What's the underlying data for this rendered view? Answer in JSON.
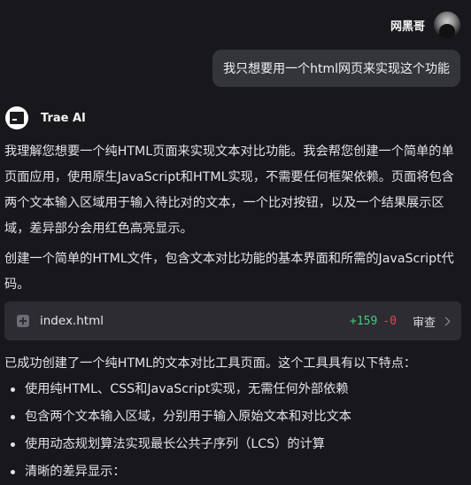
{
  "user": {
    "name": "网黑哥",
    "message": "我只想要用一个html网页来实现这个功能"
  },
  "assistant": {
    "name": "Trae AI",
    "intro": "我理解您想要一个纯HTML页面来实现文本对比功能。我会帮您创建一个简单的单页面应用，使用原生JavaScript和HTML实现，不需要任何框架依赖。页面将包含两个文本输入区域用于输入待比对的文本，一个比对按钮，以及一个结果展示区域，差异部分会用红色高亮显示。",
    "step": "创建一个简单的HTML文件，包含文本对比功能的基本界面和所需的JavaScript代码。",
    "file_card": {
      "file_name": "index.html",
      "additions": "+159",
      "deletions": "-0",
      "view_label": "审查"
    },
    "summary": "已成功创建了一个纯HTML的文本对比工具页面。这个工具具有以下特点：",
    "features": [
      "使用纯HTML、CSS和JavaScript实现，无需任何外部依赖",
      "包含两个文本输入区域，分别用于输入原始文本和对比文本",
      "使用动态规划算法实现最长公共子序列（LCS）的计算",
      "清晰的差异显示："
    ]
  },
  "colors": {
    "background": "#18181c",
    "user_bubble": "#34343b",
    "file_card": "#2c2c32",
    "additions": "#47c97a",
    "deletions": "#e0484b"
  }
}
